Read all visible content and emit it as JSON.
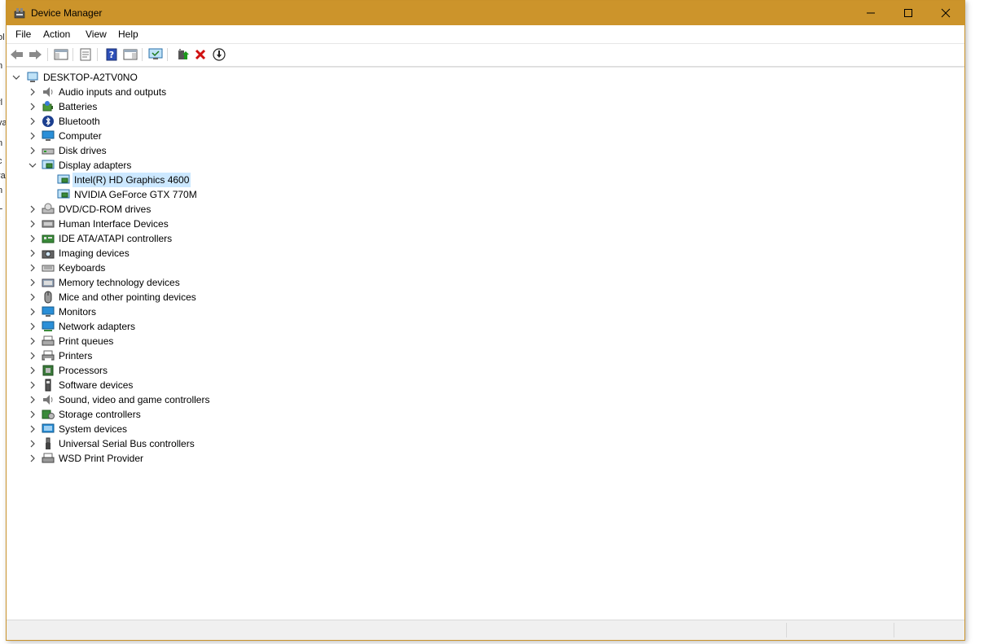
{
  "window": {
    "title": "Device Manager",
    "titlebar_color": "#cc942b"
  },
  "background_fragments": [
    "ol",
    "n",
    "rl",
    "va",
    "n",
    "c",
    "ra",
    "n",
    "L",
    "f"
  ],
  "menu": [
    "File",
    "Action",
    "View",
    "Help"
  ],
  "toolbar": [
    {
      "name": "back-arrow-icon",
      "enabled": false
    },
    {
      "name": "forward-arrow-icon",
      "enabled": false
    },
    {
      "name": "show-hide-console-tree-icon"
    },
    {
      "name": "properties-icon"
    },
    {
      "name": "help-icon"
    },
    {
      "name": "action-pane-icon"
    },
    {
      "name": "scan-hardware-changes-icon"
    },
    {
      "name": "update-driver-icon"
    },
    {
      "name": "uninstall-device-icon"
    },
    {
      "name": "disable-device-icon"
    }
  ],
  "tree": {
    "root": "DESKTOP-A2TV0NO",
    "categories": [
      {
        "label": "Audio inputs and outputs",
        "icon": "speaker-icon"
      },
      {
        "label": "Batteries",
        "icon": "battery-icon"
      },
      {
        "label": "Bluetooth",
        "icon": "bluetooth-icon"
      },
      {
        "label": "Computer",
        "icon": "computer-icon"
      },
      {
        "label": "Disk drives",
        "icon": "disk-drive-icon"
      },
      {
        "label": "Display adapters",
        "icon": "display-adapter-icon",
        "expanded": true,
        "children": [
          {
            "label": "Intel(R) HD Graphics 4600",
            "selected": true
          },
          {
            "label": "NVIDIA GeForce GTX 770M"
          }
        ]
      },
      {
        "label": "DVD/CD-ROM drives",
        "icon": "dvd-drive-icon"
      },
      {
        "label": "Human Interface Devices",
        "icon": "hid-icon"
      },
      {
        "label": "IDE ATA/ATAPI controllers",
        "icon": "ide-controller-icon"
      },
      {
        "label": "Imaging devices",
        "icon": "camera-icon"
      },
      {
        "label": "Keyboards",
        "icon": "keyboard-icon"
      },
      {
        "label": "Memory technology devices",
        "icon": "memory-icon"
      },
      {
        "label": "Mice and other pointing devices",
        "icon": "mouse-icon"
      },
      {
        "label": "Monitors",
        "icon": "monitor-icon"
      },
      {
        "label": "Network adapters",
        "icon": "network-adapter-icon"
      },
      {
        "label": "Print queues",
        "icon": "print-queue-icon"
      },
      {
        "label": "Printers",
        "icon": "printer-icon"
      },
      {
        "label": "Processors",
        "icon": "processor-icon"
      },
      {
        "label": "Software devices",
        "icon": "software-device-icon"
      },
      {
        "label": "Sound, video and game controllers",
        "icon": "sound-icon"
      },
      {
        "label": "Storage controllers",
        "icon": "storage-controller-icon"
      },
      {
        "label": "System devices",
        "icon": "system-device-icon"
      },
      {
        "label": "Universal Serial Bus controllers",
        "icon": "usb-icon"
      },
      {
        "label": "WSD Print Provider",
        "icon": "wsd-printer-icon"
      }
    ]
  },
  "colors": {
    "selection": "#cce8ff",
    "uninstall_red": "#d01010",
    "accent_blue": "#2a8fd8"
  }
}
